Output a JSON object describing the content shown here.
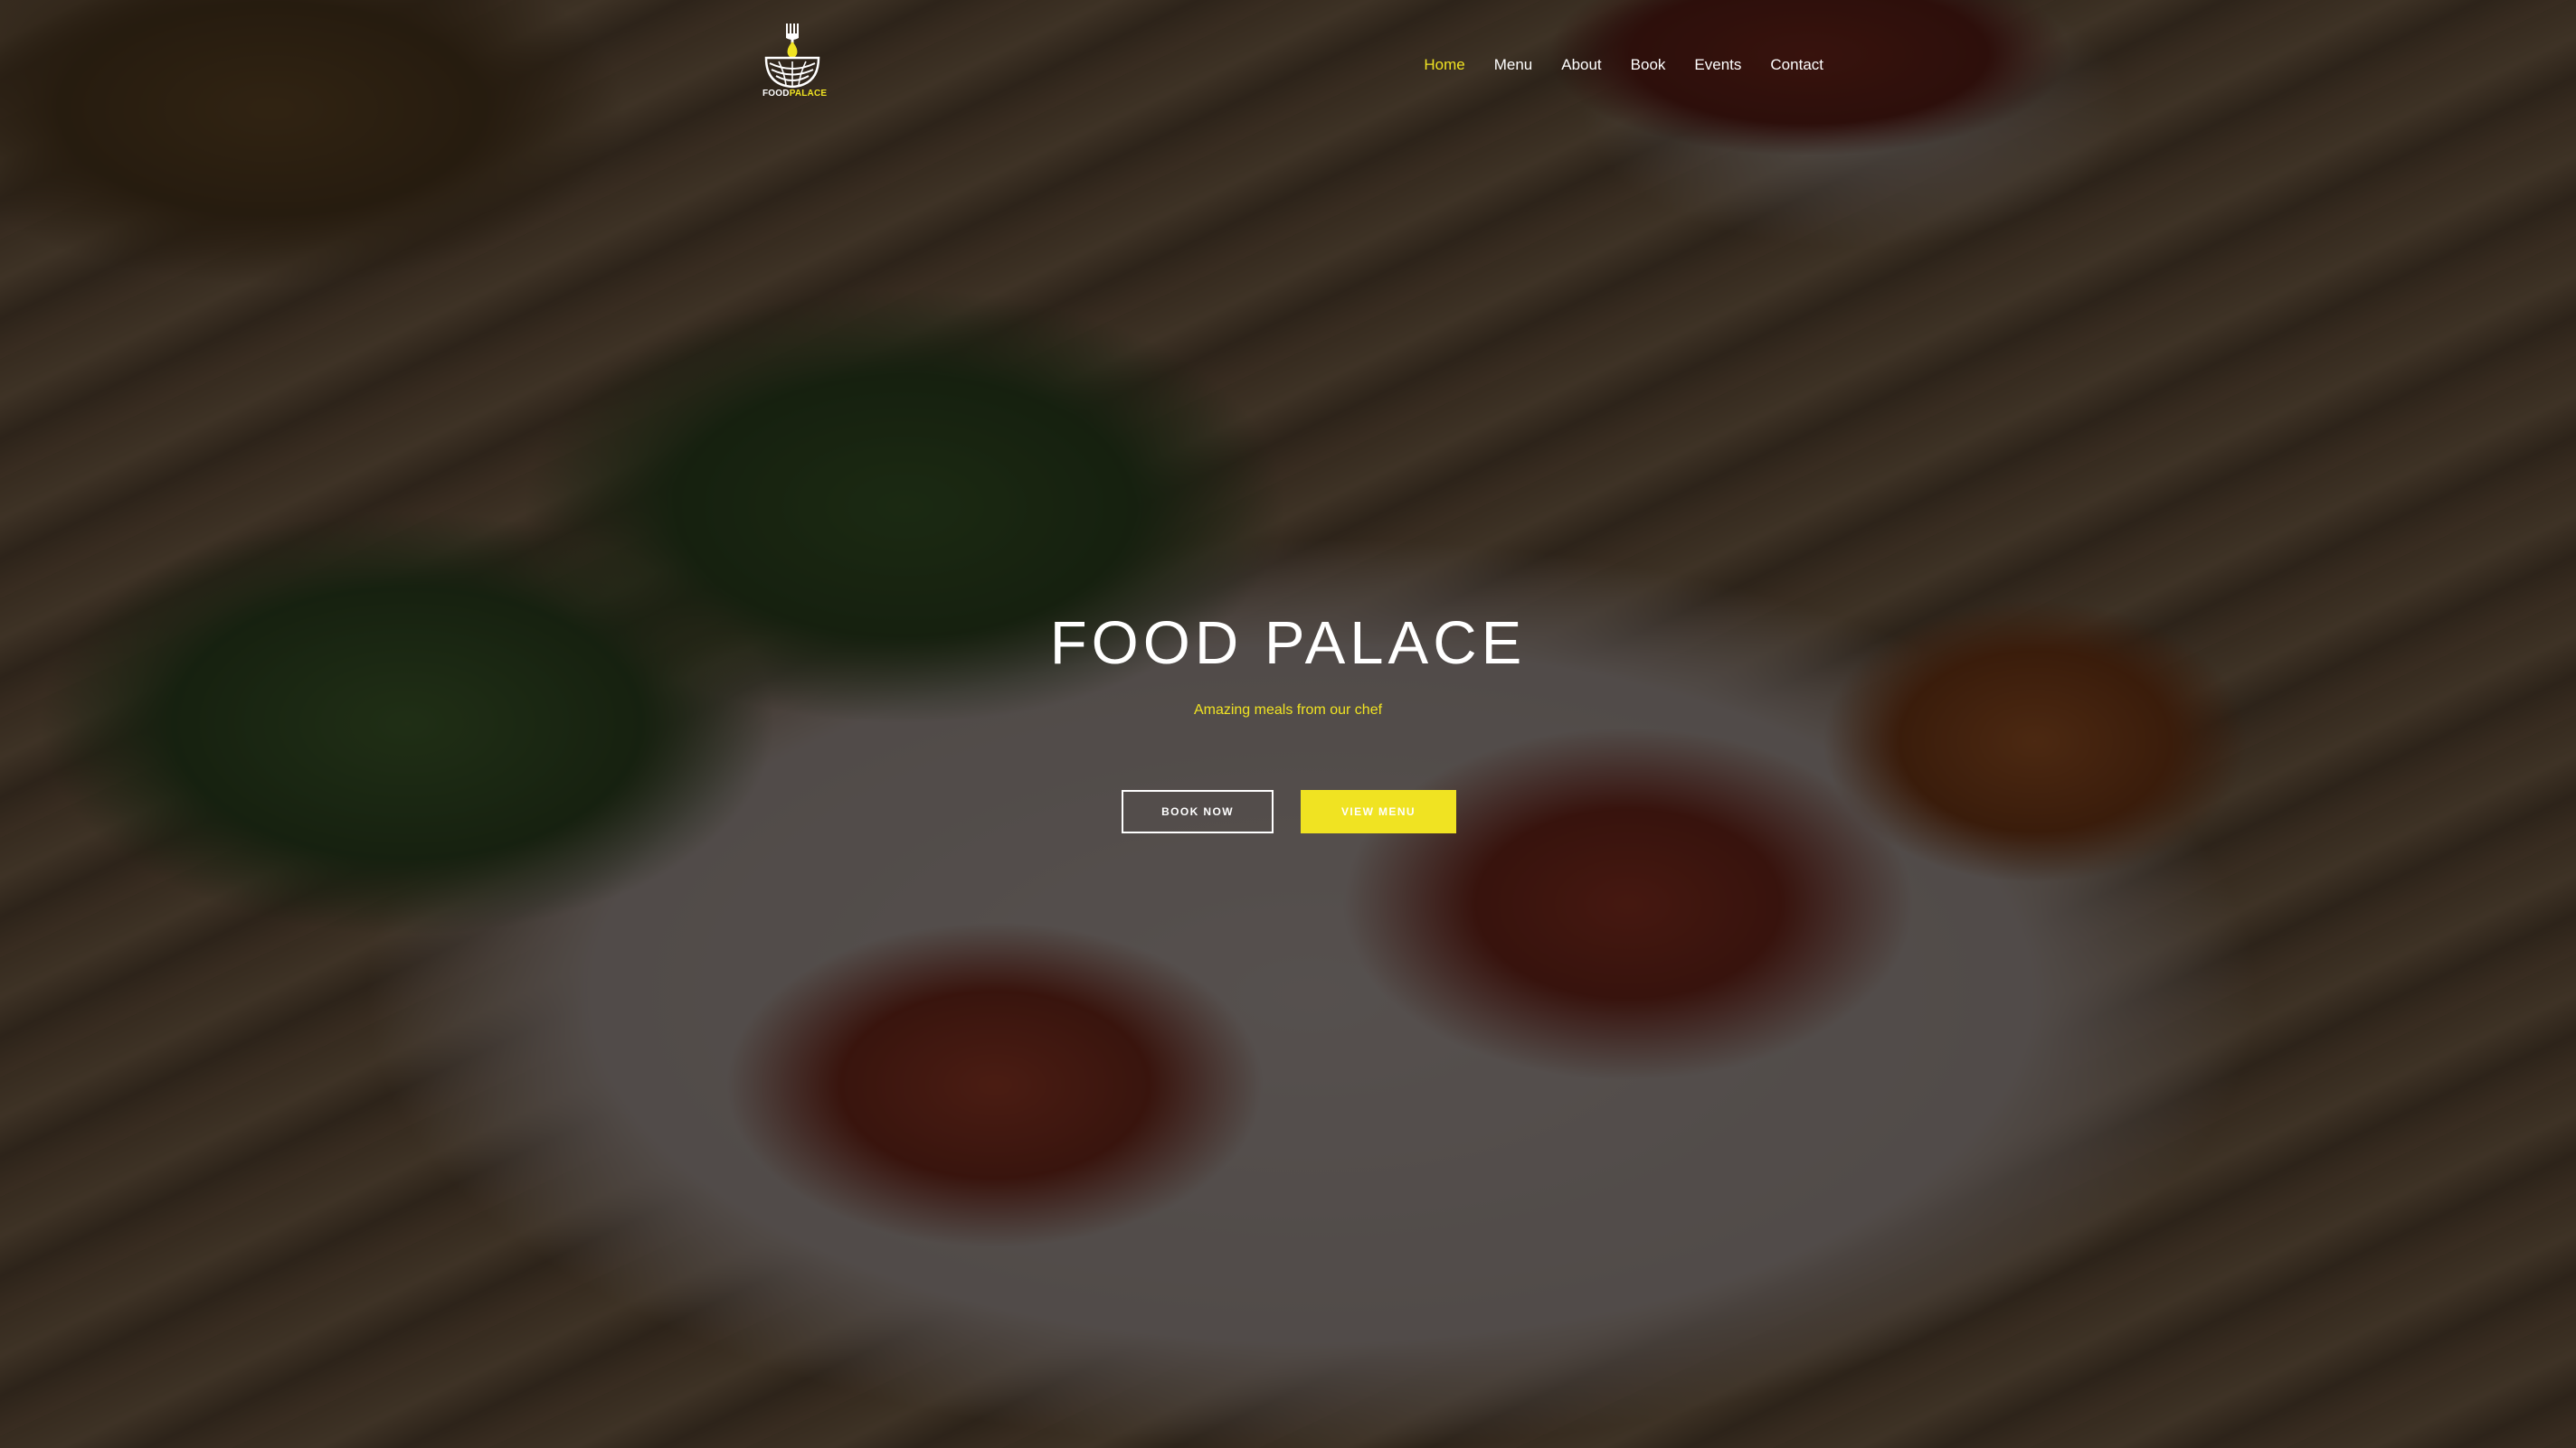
{
  "brand": {
    "logo_part1": "FOOD",
    "logo_part2": "PALACE"
  },
  "nav": {
    "items": [
      {
        "label": "Home",
        "active": true
      },
      {
        "label": "Menu",
        "active": false
      },
      {
        "label": "About",
        "active": false
      },
      {
        "label": "Book",
        "active": false
      },
      {
        "label": "Events",
        "active": false
      },
      {
        "label": "Contact",
        "active": false
      }
    ]
  },
  "hero": {
    "title": "FOOD PALACE",
    "subtitle": "Amazing meals from our chef",
    "book_button": "BOOK NOW",
    "menu_button": "VIEW MENU"
  },
  "colors": {
    "accent": "#f0e322",
    "text": "#ffffff"
  },
  "icons": {
    "logo": "fork-bowl-logo-icon"
  }
}
